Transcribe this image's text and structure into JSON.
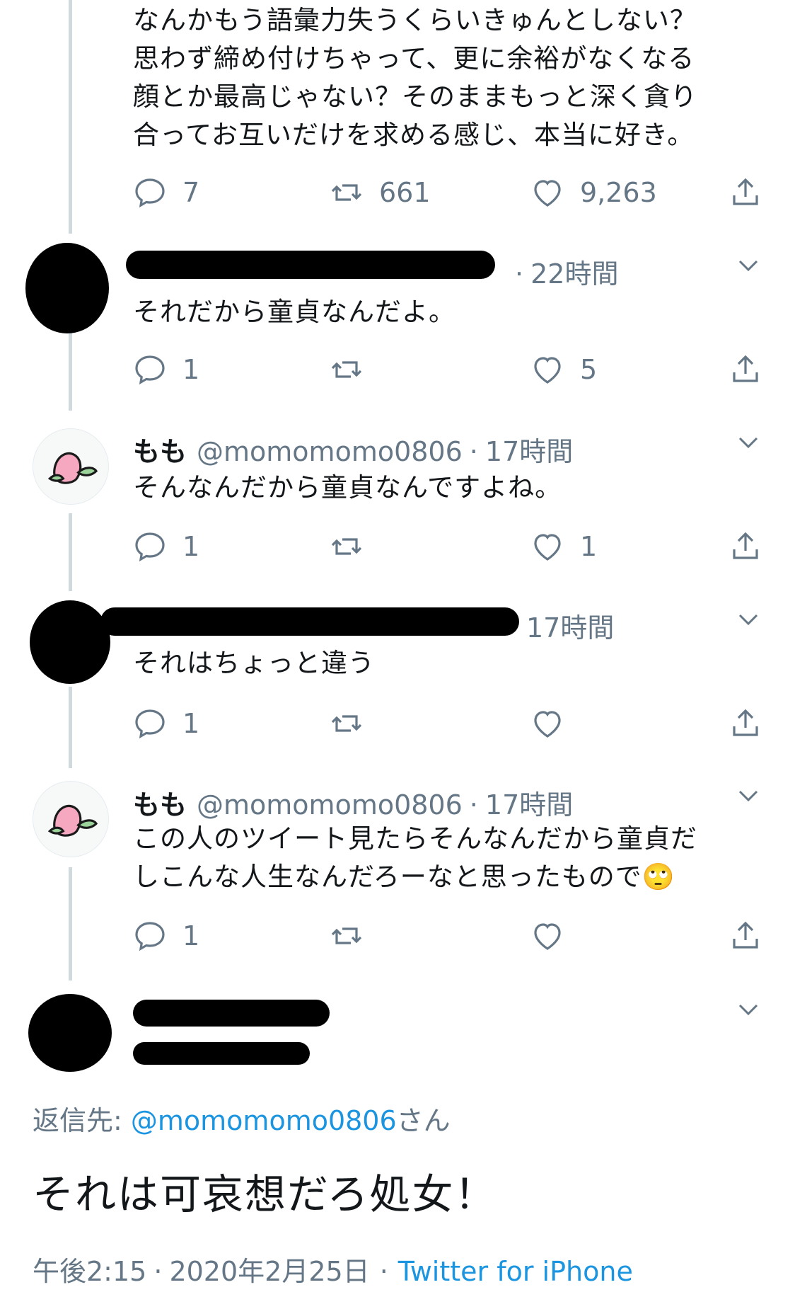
{
  "top_tweet": {
    "lines": [
      "なんかもう語彙力失うくらいきゅんとしない？",
      "思わず締め付けちゃって、更に余裕がなくなる",
      "顔とか最高じゃない？そのままもっと深く貪り",
      "合ってお互いだけを求める感じ、本当に好き。"
    ],
    "replies": "7",
    "retweets": "661",
    "likes": "9,263"
  },
  "reply1": {
    "time": "22時間",
    "text": "それだから童貞なんだよ。",
    "replies": "1",
    "likes": "5"
  },
  "reply2": {
    "name": "もも",
    "handle": "@momomomo0806",
    "time": "17時間",
    "text": "そんなんだから童貞なんですよね。",
    "replies": "1",
    "likes": "1"
  },
  "reply3": {
    "time": "17時間",
    "text": "それはちょっと違う",
    "replies": "1"
  },
  "reply4": {
    "name": "もも",
    "handle": "@momomomo0806",
    "time": "17時間",
    "lines": [
      "この人のツイート見たらそんなんだから童貞だ",
      "しこんな人生なんだろーなと思ったもので🙄"
    ],
    "replies": "1"
  },
  "main": {
    "reply_label": "返信先: ",
    "reply_handle": "@momomomo0806",
    "reply_suffix": "さん",
    "text": "それは可哀想だろ処女！",
    "time": "午後2:15",
    "date": "2020年2月25日",
    "client": "Twitter for iPhone"
  },
  "colors": {
    "link": "#1b95e0",
    "muted": "#657786",
    "line": "#cfd9de"
  }
}
